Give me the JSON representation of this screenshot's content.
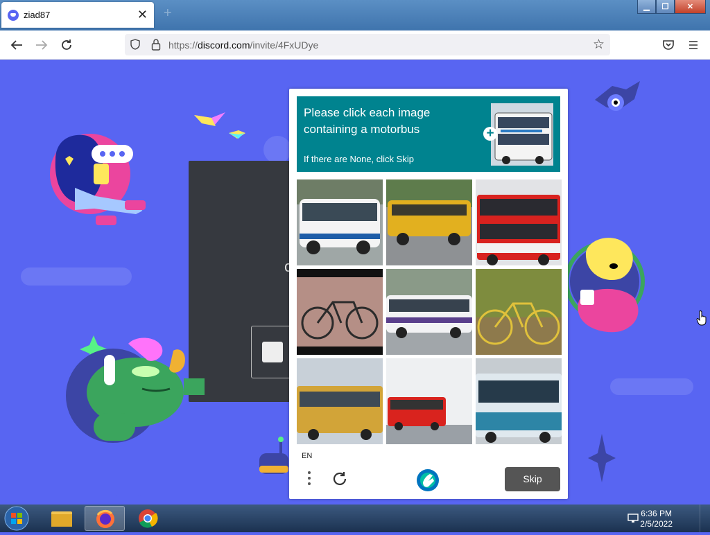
{
  "browser": {
    "tab_title": "ziad87",
    "new_tab_label": "+",
    "url_prefix": "https://",
    "url_domain": "discord.com",
    "url_path": "/invite/4FxUDye",
    "icons": [
      "back-icon",
      "forward-icon",
      "reload-icon",
      "shield-icon",
      "lock-icon",
      "bookmark-star-icon",
      "pocket-icon",
      "hamburger-menu-icon"
    ]
  },
  "captcha": {
    "prompt": "Please click each image containing a motorbus",
    "hint": "If there are None, click Skip",
    "language": "EN",
    "skip_label": "Skip",
    "header_color": "#00838f",
    "tiles": [
      {
        "subject": "white coach bus"
      },
      {
        "subject": "yellow school bus"
      },
      {
        "subject": "red double-decker bus"
      },
      {
        "subject": "bicycle"
      },
      {
        "subject": "white bus"
      },
      {
        "subject": "yellow bicycle"
      },
      {
        "subject": "yellow bus"
      },
      {
        "subject": "red bus"
      },
      {
        "subject": "blue bus"
      }
    ]
  },
  "taskbar": {
    "time": "6:36 PM",
    "date": "2/5/2022"
  },
  "colors": {
    "discord_blurple": "#5865f2",
    "dark_card": "#36393f",
    "skip_button": "#555555"
  }
}
